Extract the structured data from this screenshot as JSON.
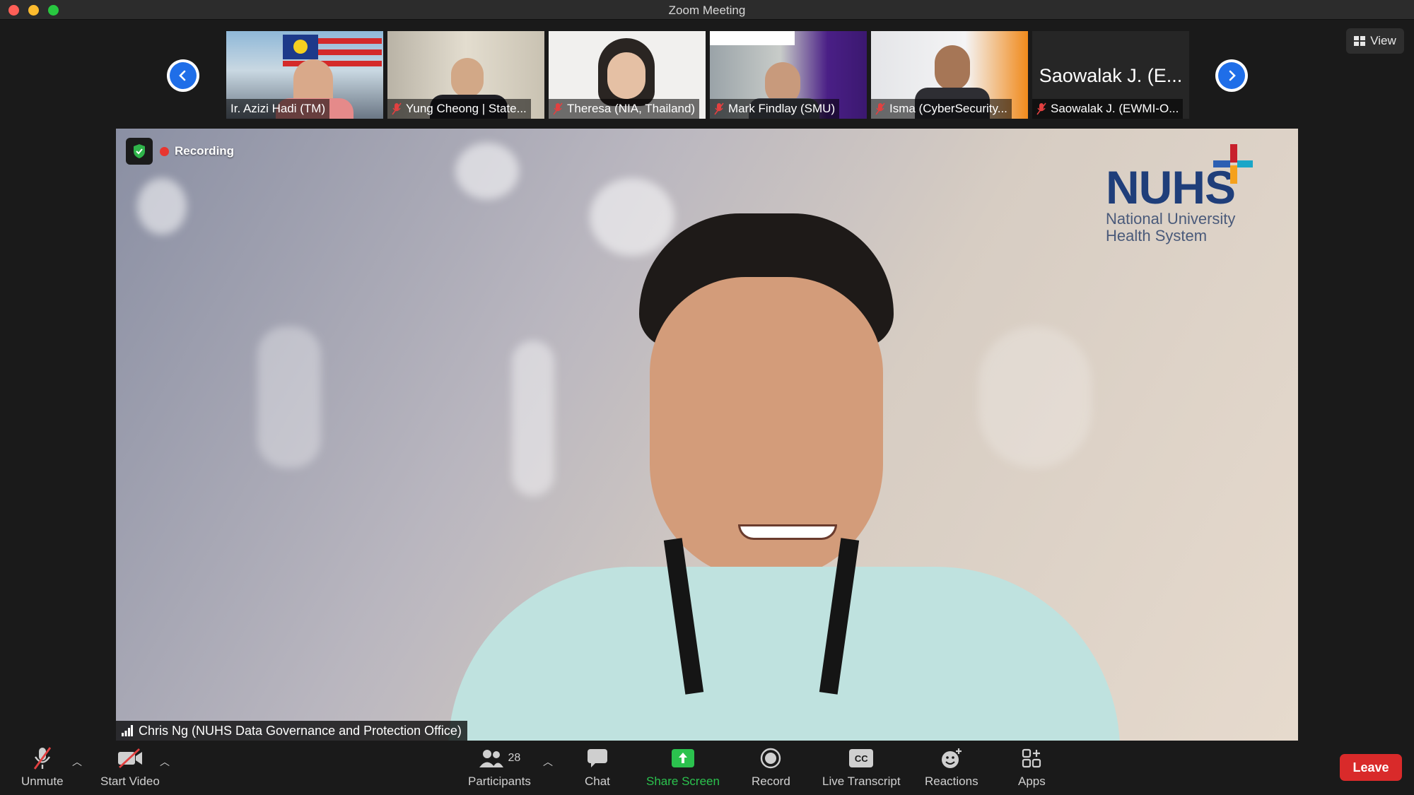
{
  "window": {
    "title": "Zoom Meeting"
  },
  "filmstrip": {
    "participants": [
      {
        "name": "Ir. Azizi Hadi (TM)",
        "muted": false
      },
      {
        "name": "Yung Cheong | State...",
        "muted": true
      },
      {
        "name": "Theresa (NIA, Thailand)",
        "muted": true
      },
      {
        "name": "Mark Findlay (SMU)",
        "muted": true
      },
      {
        "name": "Isma (CyberSecurity...",
        "muted": true
      },
      {
        "name": "Saowalak J. (EWMI-O...",
        "muted": true,
        "big_name": "Saowalak J. (E..."
      }
    ],
    "view_label": "View"
  },
  "main": {
    "recording_label": "Recording",
    "speaker_name": "Chris Ng (NUHS Data Governance and Protection Office)",
    "logo": {
      "word": "NUHS",
      "line1": "National University",
      "line2": "Health System"
    }
  },
  "toolbar": {
    "unmute": "Unmute",
    "start_video": "Start Video",
    "participants": "Participants",
    "participant_count": "28",
    "chat": "Chat",
    "share_screen": "Share Screen",
    "record": "Record",
    "live_transcript": "Live Transcript",
    "cc": "CC",
    "reactions": "Reactions",
    "apps": "Apps",
    "leave": "Leave"
  },
  "colors": {
    "share_green": "#2bc24e",
    "leave_red": "#d92a2a",
    "nav_blue": "#1f6ee8",
    "rec_red": "#e8362f"
  }
}
